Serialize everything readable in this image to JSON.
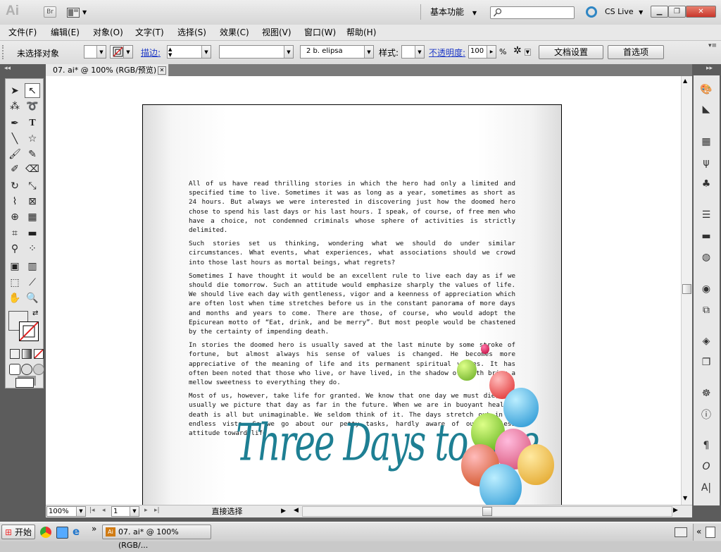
{
  "app": {
    "logo": "Ai",
    "bridge_label": "Br",
    "workspace_label": "基本功能",
    "cs_live": "CS Live",
    "search_placeholder": ""
  },
  "menu": [
    "文件(F)",
    "编辑(E)",
    "对象(O)",
    "文字(T)",
    "选择(S)",
    "效果(C)",
    "视图(V)",
    "窗口(W)",
    "帮助(H)"
  ],
  "control": {
    "selection_status": "未选择对象",
    "stroke_label": "描边:",
    "brush_value": "2 b. elipsa",
    "style_label": "样式:",
    "opacity_label": "不透明度:",
    "opacity_value": "100",
    "opacity_unit": "%",
    "doc_setup_button": "文档设置",
    "preferences_button": "首选项"
  },
  "document": {
    "tab_title": "07. ai* @ 100% (RGB/预览)",
    "paragraphs": [
      "All of us have read thrilling stories in which the hero had only a limited and specified time to live. Sometimes it was as long as a year, sometimes as short as 24 hours. But always we were interested in discovering just how the doomed hero chose to spend his last days or his last hours. I speak, of course, of free men who have a choice, not condemned criminals whose sphere of activities is strictly delimited.",
      "Such stories set us thinking, wondering what we should do under similar circumstances. What events, what experiences, what associations should we crowd into those last hours as mortal beings, what regrets?",
      "Sometimes I have thought it would be an excellent rule to live each day as if we should die tomorrow. Such an attitude would emphasize sharply the values of life. We should live each day with gentleness, vigor and a keenness of appreciation which are often lost when time stretches before us in the constant panorama of more days and months and years to come. There are those, of course, who would adopt the Epicurean motto of “Eat, drink, and be merry”. But most people would be chastened by the certainty of impending death.",
      "In stories the doomed hero is usually saved at the last minute by some stroke of fortune, but almost always his sense of values is changed. He becomes more appreciative of the meaning of life and its permanent spiritual values. It has often been noted that those who live, or have lived, in the shadow of death bring a mellow sweetness to everything they do.",
      "Most of us, however, take life for granted. We know that one day we must die, but usually we picture that day as far in the future. When we are in buoyant health, death is all but unimaginable. We seldom think of it. The days stretch out in an endless vista. So we go about our petty tasks, hardly aware of our listless attitude toward life."
    ],
    "title_art": "Three Days to See"
  },
  "status": {
    "zoom": "100%",
    "page": "1",
    "tool_name": "直接选择"
  },
  "taskbar": {
    "start": "开始",
    "window_item": "07. ai* @ 100% (RGB/..."
  },
  "colors": {
    "title_teal": "#1e7f93",
    "panel_bg": "#5c5c5c",
    "link_blue": "#1f3ac7",
    "close_red": "#c9362b"
  }
}
